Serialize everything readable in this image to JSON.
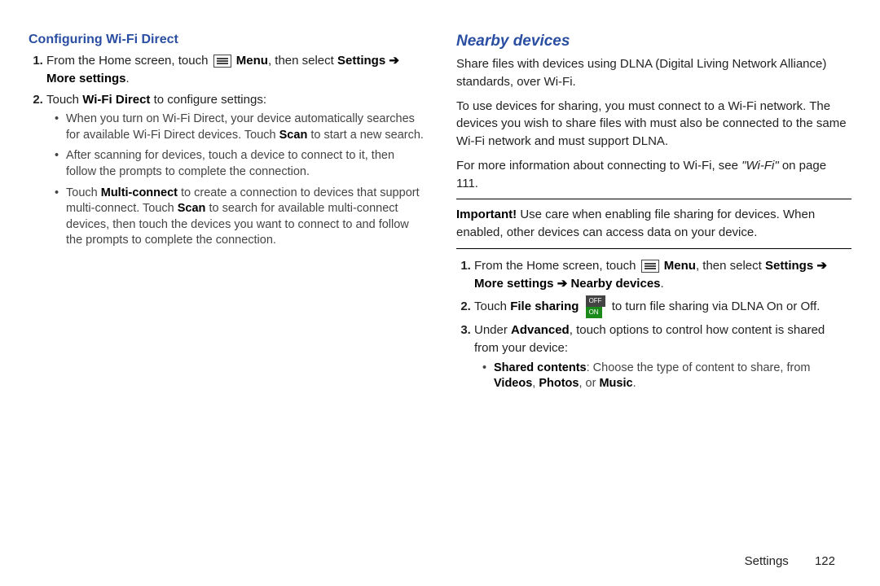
{
  "left": {
    "heading": "Configuring Wi-Fi Direct",
    "step1_a": "From the Home screen, touch ",
    "step1_menu": "Menu",
    "step1_b": ", then select ",
    "step1_path_a": "Settings",
    "arrow": "➔",
    "step1_path_b": "More settings",
    "step1_end": ".",
    "step2_a": "Touch ",
    "step2_wfd": "Wi-Fi Direct",
    "step2_b": " to configure settings:",
    "b1_a": "When you turn on Wi-Fi Direct, your device automatically searches for available Wi-Fi Direct devices. Touch ",
    "b1_scan": "Scan",
    "b1_b": " to start a new search.",
    "b2": "After scanning for devices, touch a device to connect to it, then follow the prompts to complete the connection.",
    "b3_a": "Touch ",
    "b3_mc": "Multi-connect",
    "b3_b": " to create a connection to devices that support multi-connect. Touch ",
    "b3_scan": "Scan",
    "b3_c": " to search for available multi-connect devices, then touch the devices you want to connect to and follow the prompts to complete the connection."
  },
  "right": {
    "heading": "Nearby devices",
    "p1": "Share files with devices using DLNA (Digital Living Network Alliance) standards, over Wi-Fi.",
    "p2": "To use devices for sharing, you must connect to a Wi-Fi network. The devices you wish to share files with must also be connected to the same Wi-Fi network and must support DLNA.",
    "p3_a": "For more information about connecting to Wi-Fi, see ",
    "p3_ref": "\"Wi-Fi\"",
    "p3_b": " on page 111.",
    "imp_label": "Important! ",
    "imp_body": "Use care when enabling file sharing for devices. When enabled, other devices can access data on your device.",
    "s1_a": "From the Home screen, touch ",
    "s1_menu": "Menu",
    "s1_b": ", then select ",
    "s1_path_a": "Settings",
    "s1_path_b": "More settings",
    "s1_path_c": "Nearby devices",
    "s1_end": ".",
    "s2_a": "Touch ",
    "s2_fs": "File sharing",
    "s2_b": " to turn file sharing via DLNA On or Off.",
    "s3_a": "Under ",
    "s3_adv": "Advanced",
    "s3_b": ", touch options to control how content is shared from your device:",
    "sb1_a": "Shared contents",
    "sb1_b": ": Choose the type of content to share, from ",
    "sb1_v": "Videos",
    "sb1_sep": ", ",
    "sb1_p": "Photos",
    "sb1_or": ", or ",
    "sb1_m": "Music",
    "sb1_end": ".",
    "toggle_off": "OFF",
    "toggle_on": "ON"
  },
  "footer": {
    "section": "Settings",
    "page": "122"
  }
}
